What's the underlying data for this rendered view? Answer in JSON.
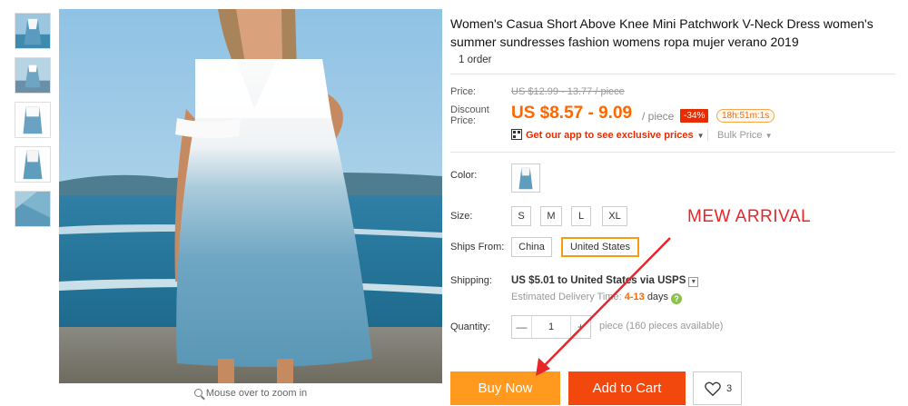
{
  "gallery": {
    "thumbnails": [
      "thumb-1",
      "thumb-2",
      "thumb-3",
      "thumb-4",
      "thumb-5"
    ],
    "zoom_hint": "Mouse over to zoom in"
  },
  "product": {
    "title": "Women's Casua Short Above Knee Mini Patchwork V-Neck Dress women's summer sundresses fashion womens ropa mujer verano 2019",
    "orders": "1 order"
  },
  "price": {
    "label": "Price:",
    "original": "US $12.99 - 13.77 / piece",
    "discount_label": "Discount Price:",
    "discount": "US $8.57 - 9.09",
    "unit": "/ piece",
    "off": "-34%",
    "timer": "18h:51m:1s",
    "app_promo": "Get our app to see exclusive prices",
    "bulk": "Bulk Price"
  },
  "options": {
    "color_label": "Color:",
    "size_label": "Size:",
    "sizes": [
      "S",
      "M",
      "L",
      "XL"
    ],
    "ships_from_label": "Ships From:",
    "ships_from": [
      "China",
      "United States"
    ],
    "ships_from_selected": "United States"
  },
  "shipping": {
    "label": "Shipping:",
    "cost": "US $5.01",
    "to": "to United States via USPS",
    "est_label": "Estimated Delivery Time:",
    "est_days": "4-13",
    "est_unit": "days"
  },
  "quantity": {
    "label": "Quantity:",
    "minus": "—",
    "value": "1",
    "plus": "+",
    "available": "piece (160 pieces available)"
  },
  "actions": {
    "buy_now": "Buy Now",
    "add_to_cart": "Add to Cart",
    "wishlist_count": "3"
  },
  "annotation": {
    "text": "MEW ARRIVAL",
    "color": "#e8262a"
  },
  "colors": {
    "accent_orange": "#ff6600",
    "buy_now": "#ff9a1f",
    "add_to_cart": "#f2470d",
    "discount_badge": "#e62e04"
  }
}
